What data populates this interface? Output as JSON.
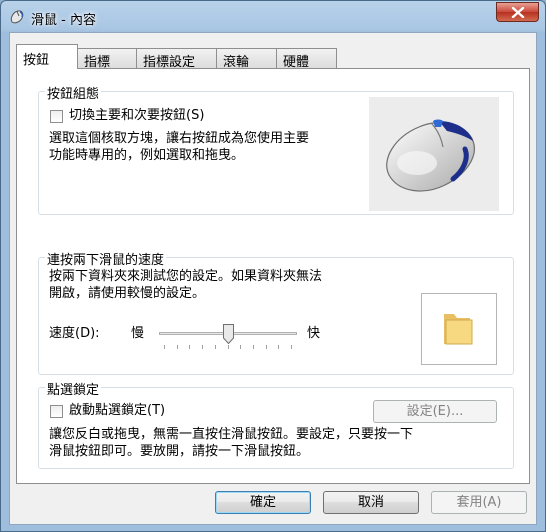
{
  "window": {
    "title": "滑鼠 - 內容"
  },
  "tabs": [
    {
      "label": "按鈕"
    },
    {
      "label": "指標"
    },
    {
      "label": "指標設定"
    },
    {
      "label": "滾輪"
    },
    {
      "label": "硬體"
    }
  ],
  "button_config": {
    "title": "按鈕組態",
    "switch_label": "切換主要和次要按鈕(S)",
    "description_line1": "選取這個核取方塊，讓右按鈕成為您使用主要",
    "description_line2": "功能時專用的，例如選取和拖曳。",
    "checked": false
  },
  "double_click": {
    "title": "連按兩下滑鼠的速度",
    "description_line1": "按兩下資料夾來測試您的設定。如果資料夾無法",
    "description_line2": "開啟，請使用較慢的設定。",
    "speed_label": "速度(D):",
    "slow_label": "慢",
    "fast_label": "快",
    "speed_value": 0.5
  },
  "click_lock": {
    "title": "點選鎖定",
    "enable_label": "啟動點選鎖定(T)",
    "settings_button": "設定(E)...",
    "description_line1": "讓您反白或拖曳，無需一直按住滑鼠按鈕。要設定，只要按一下",
    "description_line2": "滑鼠按鈕即可。要放開，請按一下滑鼠按鈕。",
    "checked": false
  },
  "footer": {
    "ok": "確定",
    "cancel": "取消",
    "apply": "套用(A)"
  },
  "colors": {
    "titlebar": "#a9c6e3",
    "close": "#c9483a",
    "dialog_bg": "#f0f0f0",
    "panel_bg": "#ffffff"
  },
  "icons": [
    "mouse-icon",
    "close-icon",
    "mouse-illustration",
    "folder-icon",
    "slider-thumb"
  ]
}
